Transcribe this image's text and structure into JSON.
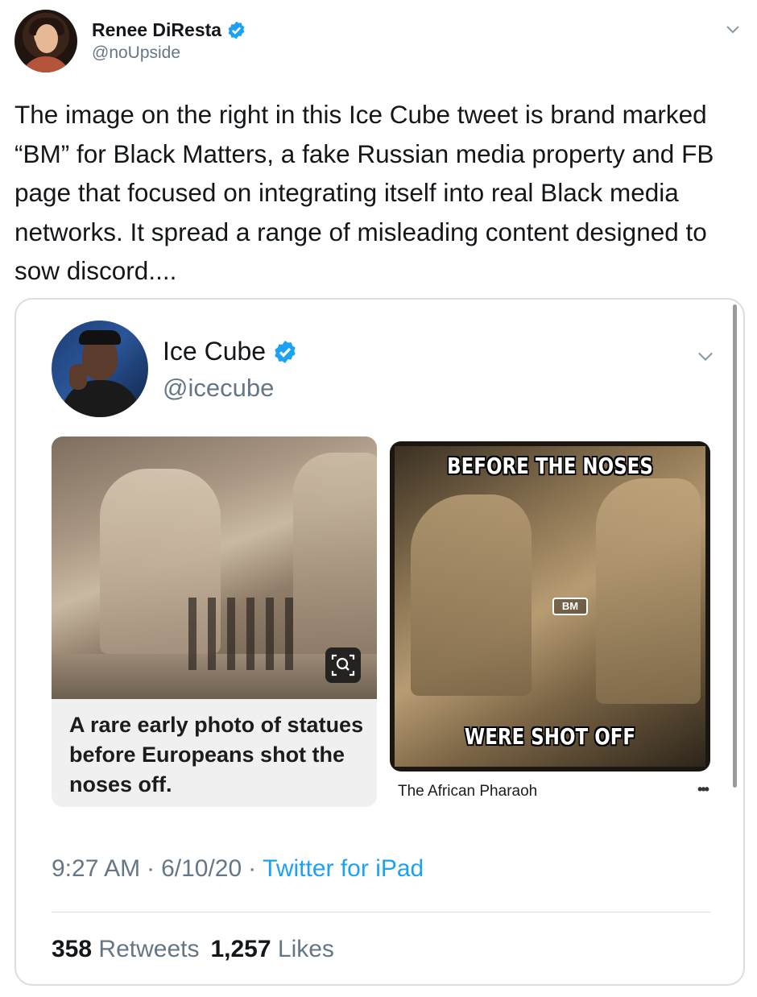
{
  "outer_tweet": {
    "name": "Renee DiResta",
    "handle": "@noUpside",
    "text": "The image on the right in this Ice Cube tweet is brand marked “BM” for Black Matters, a fake Russian media property and FB page that focused on integrating itself into real Black media networks. It spread a range of misleading content designed to sow discord...."
  },
  "quoted_tweet": {
    "name": "Ice Cube",
    "handle": "@icecube",
    "left_caption": "A rare early photo of statues before Europeans shot the noses off.",
    "meme_top": "BEFORE THE NOSES",
    "meme_bottom": "WERE SHOT OFF",
    "logo_text": "BM",
    "source": "The African Pharaoh",
    "more": "•••",
    "time": "9:27 AM",
    "date": "6/10/20",
    "separator": "·",
    "app": "Twitter for iPad",
    "retweets_count": "358",
    "retweets_label": "Retweets",
    "likes_count": "1,257",
    "likes_label": "Likes"
  },
  "colors": {
    "link": "#1da1f2",
    "secondary": "#657786",
    "verified": "#1da1f2"
  },
  "icons": [
    "verified-badge-icon",
    "chevron-down-icon",
    "lens-search-icon"
  ]
}
